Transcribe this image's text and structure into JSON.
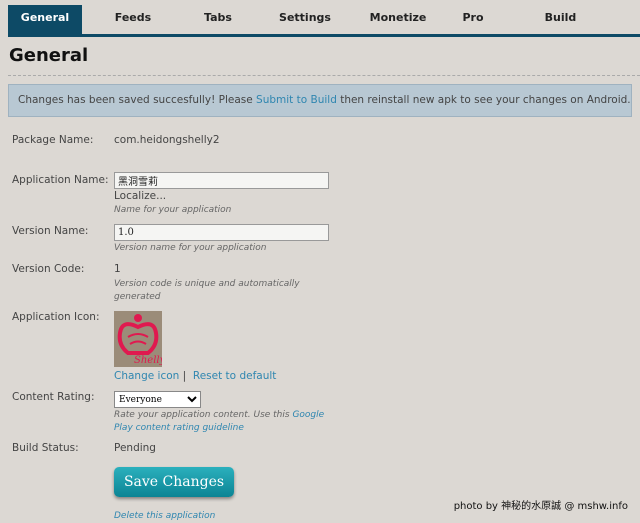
{
  "tabs": [
    {
      "label": "General",
      "active": true
    },
    {
      "label": "Feeds"
    },
    {
      "label": "Tabs"
    },
    {
      "label": "Settings"
    },
    {
      "label": "Monetize"
    },
    {
      "label": "Pro"
    },
    {
      "label": "Build"
    }
  ],
  "page_title": "General",
  "alert": {
    "before": "Changes has been saved succesfully! Please ",
    "link": "Submit to Build",
    "after": " then reinstall new apk to see your changes on Android."
  },
  "form": {
    "package_label": "Package Name:",
    "package_value": "com.heidongshelly2",
    "app_name_label": "Application Name:",
    "app_name_value": "黑洞雪莉",
    "localize": "Localize...",
    "app_name_hint": "Name for your application",
    "version_name_label": "Version Name:",
    "version_name_value": "1.0",
    "version_name_hint": "Version name for your application",
    "version_code_label": "Version Code:",
    "version_code_value": "1",
    "version_code_hint1": "Version code is unique and automatically",
    "version_code_hint2": "generated",
    "icon_label": "Application Icon:",
    "icon_text": "Shelly",
    "change_icon": "Change icon",
    "sep": "|",
    "reset_icon": "Reset to default",
    "rating_label": "Content Rating:",
    "rating_value": "Everyone",
    "rating_hint1": "Rate your application content. Use this ",
    "rating_hint_link1": "Google",
    "rating_hint_link2": "Play content rating guideline",
    "build_status_label": "Build Status:",
    "build_status_value": "Pending",
    "save": "Save Changes",
    "delete": "Delete this application"
  },
  "watermark": "photo by 神秘的水原誠 @ mshw.info",
  "colors": {
    "accent": "#0d4a66",
    "button": "#1a9aa8",
    "link": "#2f86b0"
  }
}
